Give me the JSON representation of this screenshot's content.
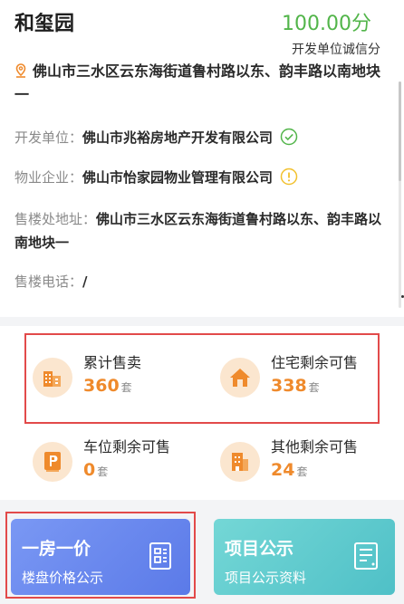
{
  "project": {
    "name": "和玺园",
    "score": "100.00分",
    "score_label": "开发单位诚信分",
    "address": "佛山市三水区云东海街道鲁村路以东、韵丰路以南地块一"
  },
  "details": {
    "developer_label": "开发单位：",
    "developer_value": "佛山市兆裕房地产开发有限公司",
    "property_label": "物业企业：",
    "property_value": "佛山市怡家园物业管理有限公司",
    "sales_office_label": "售楼处地址：",
    "sales_office_value": "佛山市三水区云东海街道鲁村路以东、韵丰路以南地块一",
    "phone_label": "售楼电话：",
    "phone_value": "/"
  },
  "stats": [
    {
      "label": "累计售卖",
      "value": "360",
      "unit": "套",
      "icon": "building-icon"
    },
    {
      "label": "住宅剩余可售",
      "value": "338",
      "unit": "套",
      "icon": "house-icon"
    },
    {
      "label": "车位剩余可售",
      "value": "0",
      "unit": "套",
      "icon": "parking-icon"
    },
    {
      "label": "其他剩余可售",
      "value": "24",
      "unit": "套",
      "icon": "office-icon"
    }
  ],
  "tiles": [
    {
      "title": "一房一价",
      "subtitle": "楼盘价格公示",
      "icon": "price-list-icon"
    },
    {
      "title": "项目公示",
      "subtitle": "项目公示资料",
      "icon": "document-icon"
    }
  ],
  "colors": {
    "score_green": "#52b54a",
    "accent_orange": "#ef8a2c",
    "highlight_red": "#e24a4a",
    "tile_blue": "#5b7ae8",
    "tile_teal": "#4fc0c7"
  }
}
